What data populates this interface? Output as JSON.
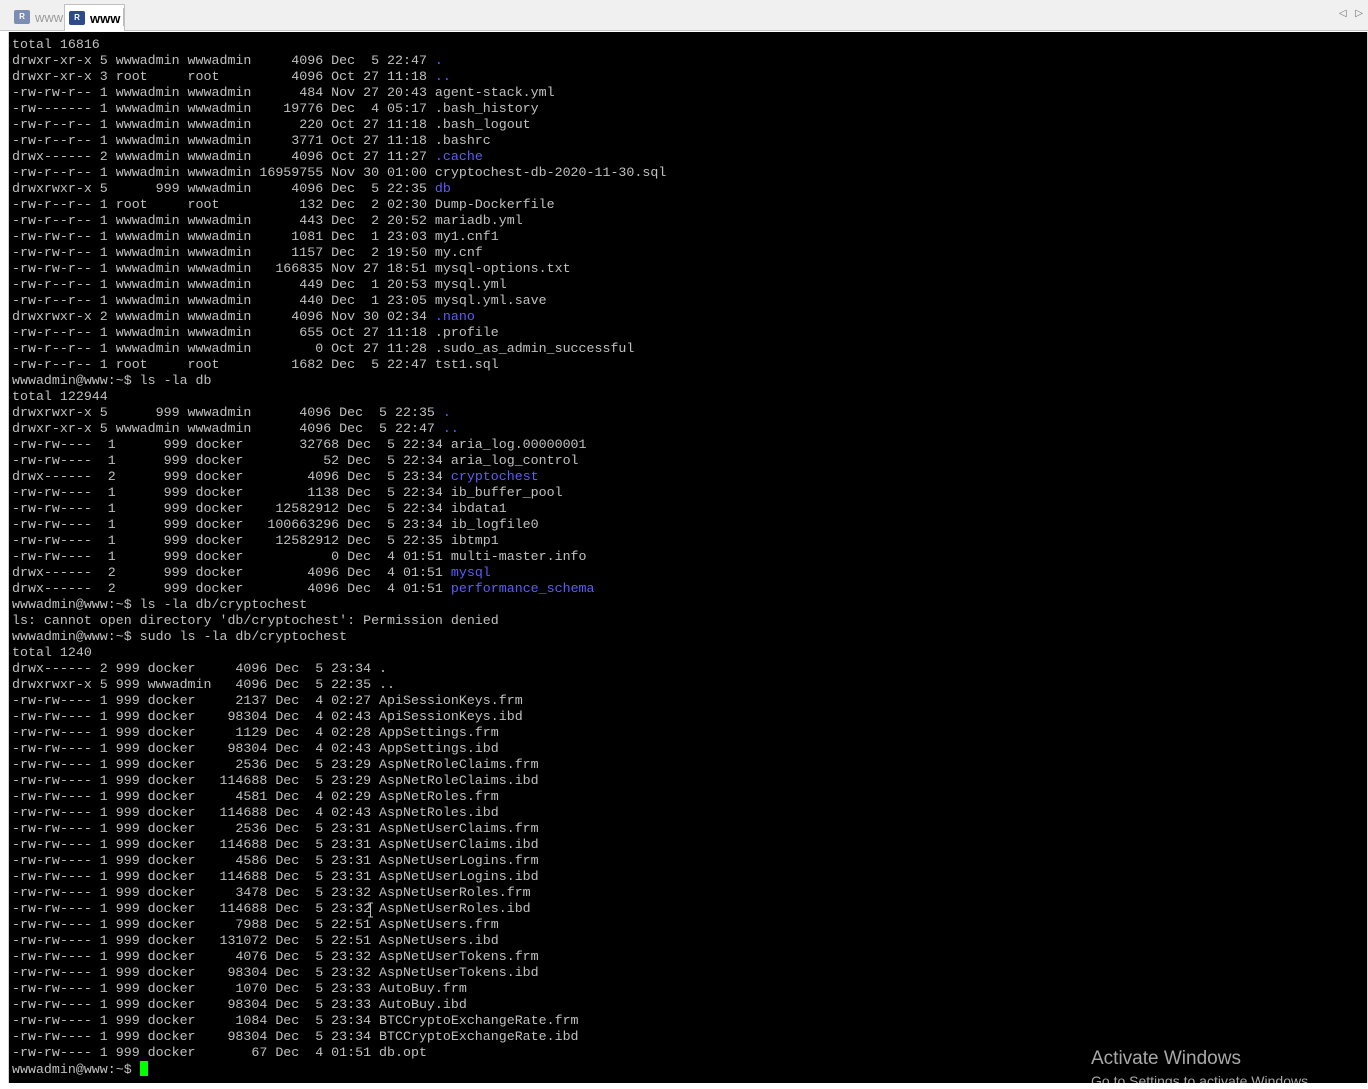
{
  "tabs": [
    {
      "label": "www",
      "icon": "putty-session-icon",
      "active": false
    },
    {
      "label": "www",
      "icon": "putty-session-icon",
      "active": true
    }
  ],
  "tab_icon_text": "R",
  "scroll_arrows": "◁ ▷",
  "terminal": {
    "lines": [
      [
        {
          "t": "total 16816"
        }
      ],
      [
        {
          "t": "drwxr-xr-x 5 wwwadmin wwwadmin     4096 Dec  5 22:47 "
        },
        {
          "t": ".",
          "dir": true
        }
      ],
      [
        {
          "t": "drwxr-xr-x 3 root     root         4096 Oct 27 11:18 "
        },
        {
          "t": "..",
          "dir": true
        }
      ],
      [
        {
          "t": "-rw-rw-r-- 1 wwwadmin wwwadmin      484 Nov 27 20:43 agent-stack.yml"
        }
      ],
      [
        {
          "t": "-rw------- 1 wwwadmin wwwadmin    19776 Dec  4 05:17 .bash_history"
        }
      ],
      [
        {
          "t": "-rw-r--r-- 1 wwwadmin wwwadmin      220 Oct 27 11:18 .bash_logout"
        }
      ],
      [
        {
          "t": "-rw-r--r-- 1 wwwadmin wwwadmin     3771 Oct 27 11:18 .bashrc"
        }
      ],
      [
        {
          "t": "drwx------ 2 wwwadmin wwwadmin     4096 Oct 27 11:27 "
        },
        {
          "t": ".cache",
          "dir": true
        }
      ],
      [
        {
          "t": "-rw-r--r-- 1 wwwadmin wwwadmin 16959755 Nov 30 01:00 cryptochest-db-2020-11-30.sql"
        }
      ],
      [
        {
          "t": "drwxrwxr-x 5      999 wwwadmin     4096 Dec  5 22:35 "
        },
        {
          "t": "db",
          "dir": true
        }
      ],
      [
        {
          "t": "-rw-r--r-- 1 root     root          132 Dec  2 02:30 Dump-Dockerfile"
        }
      ],
      [
        {
          "t": "-rw-r--r-- 1 wwwadmin wwwadmin      443 Dec  2 20:52 mariadb.yml"
        }
      ],
      [
        {
          "t": "-rw-rw-r-- 1 wwwadmin wwwadmin     1081 Dec  1 23:03 my1.cnf1"
        }
      ],
      [
        {
          "t": "-rw-rw-r-- 1 wwwadmin wwwadmin     1157 Dec  2 19:50 my.cnf"
        }
      ],
      [
        {
          "t": "-rw-rw-r-- 1 wwwadmin wwwadmin   166835 Nov 27 18:51 mysql-options.txt"
        }
      ],
      [
        {
          "t": "-rw-r--r-- 1 wwwadmin wwwadmin      449 Dec  1 20:53 mysql.yml"
        }
      ],
      [
        {
          "t": "-rw-r--r-- 1 wwwadmin wwwadmin      440 Dec  1 23:05 mysql.yml.save"
        }
      ],
      [
        {
          "t": "drwxrwxr-x 2 wwwadmin wwwadmin     4096 Nov 30 02:34 "
        },
        {
          "t": ".nano",
          "dir": true
        }
      ],
      [
        {
          "t": "-rw-r--r-- 1 wwwadmin wwwadmin      655 Oct 27 11:18 .profile"
        }
      ],
      [
        {
          "t": "-rw-r--r-- 1 wwwadmin wwwadmin        0 Oct 27 11:28 .sudo_as_admin_successful"
        }
      ],
      [
        {
          "t": "-rw-r--r-- 1 root     root         1682 Dec  5 22:47 tst1.sql"
        }
      ],
      [
        {
          "t": "wwwadmin@www:~$ ls -la db"
        }
      ],
      [
        {
          "t": "total 122944"
        }
      ],
      [
        {
          "t": "drwxrwxr-x 5      999 wwwadmin      4096 Dec  5 22:35 "
        },
        {
          "t": ".",
          "dir": true
        }
      ],
      [
        {
          "t": "drwxr-xr-x 5 wwwadmin wwwadmin      4096 Dec  5 22:47 "
        },
        {
          "t": "..",
          "dir": true
        }
      ],
      [
        {
          "t": "-rw-rw----  1      999 docker       32768 Dec  5 22:34 aria_log.00000001"
        }
      ],
      [
        {
          "t": "-rw-rw----  1      999 docker          52 Dec  5 22:34 aria_log_control"
        }
      ],
      [
        {
          "t": "drwx------  2      999 docker        4096 Dec  5 23:34 "
        },
        {
          "t": "cryptochest",
          "dir": true
        }
      ],
      [
        {
          "t": "-rw-rw----  1      999 docker        1138 Dec  5 22:34 ib_buffer_pool"
        }
      ],
      [
        {
          "t": "-rw-rw----  1      999 docker    12582912 Dec  5 22:34 ibdata1"
        }
      ],
      [
        {
          "t": "-rw-rw----  1      999 docker   100663296 Dec  5 23:34 ib_logfile0"
        }
      ],
      [
        {
          "t": "-rw-rw----  1      999 docker    12582912 Dec  5 22:35 ibtmp1"
        }
      ],
      [
        {
          "t": "-rw-rw----  1      999 docker           0 Dec  4 01:51 multi-master.info"
        }
      ],
      [
        {
          "t": "drwx------  2      999 docker        4096 Dec  4 01:51 "
        },
        {
          "t": "mysql",
          "dir": true
        }
      ],
      [
        {
          "t": "drwx------  2      999 docker        4096 Dec  4 01:51 "
        },
        {
          "t": "performance_schema",
          "dir": true
        }
      ],
      [
        {
          "t": "wwwadmin@www:~$ ls -la db/cryptochest"
        }
      ],
      [
        {
          "t": "ls: cannot open directory 'db/cryptochest': Permission denied"
        }
      ],
      [
        {
          "t": "wwwadmin@www:~$ sudo ls -la db/cryptochest"
        }
      ],
      [
        {
          "t": "total 1240"
        }
      ],
      [
        {
          "t": "drwx------ 2 999 docker     4096 Dec  5 23:34 ."
        }
      ],
      [
        {
          "t": "drwxrwxr-x 5 999 wwwadmin   4096 Dec  5 22:35 .."
        }
      ],
      [
        {
          "t": "-rw-rw---- 1 999 docker     2137 Dec  4 02:27 ApiSessionKeys.frm"
        }
      ],
      [
        {
          "t": "-rw-rw---- 1 999 docker    98304 Dec  4 02:43 ApiSessionKeys.ibd"
        }
      ],
      [
        {
          "t": "-rw-rw---- 1 999 docker     1129 Dec  4 02:28 AppSettings.frm"
        }
      ],
      [
        {
          "t": "-rw-rw---- 1 999 docker    98304 Dec  4 02:43 AppSettings.ibd"
        }
      ],
      [
        {
          "t": "-rw-rw---- 1 999 docker     2536 Dec  5 23:29 AspNetRoleClaims.frm"
        }
      ],
      [
        {
          "t": "-rw-rw---- 1 999 docker   114688 Dec  5 23:29 AspNetRoleClaims.ibd"
        }
      ],
      [
        {
          "t": "-rw-rw---- 1 999 docker     4581 Dec  4 02:29 AspNetRoles.frm"
        }
      ],
      [
        {
          "t": "-rw-rw---- 1 999 docker   114688 Dec  4 02:43 AspNetRoles.ibd"
        }
      ],
      [
        {
          "t": "-rw-rw---- 1 999 docker     2536 Dec  5 23:31 AspNetUserClaims.frm"
        }
      ],
      [
        {
          "t": "-rw-rw---- 1 999 docker   114688 Dec  5 23:31 AspNetUserClaims.ibd"
        }
      ],
      [
        {
          "t": "-rw-rw---- 1 999 docker     4586 Dec  5 23:31 AspNetUserLogins.frm"
        }
      ],
      [
        {
          "t": "-rw-rw---- 1 999 docker   114688 Dec  5 23:31 AspNetUserLogins.ibd"
        }
      ],
      [
        {
          "t": "-rw-rw---- 1 999 docker     3478 Dec  5 23:32 AspNetUserRoles.frm"
        }
      ],
      [
        {
          "t": "-rw-rw---- 1 999 docker   114688 Dec  5 23:32 AspNetUserRoles.ibd"
        }
      ],
      [
        {
          "t": "-rw-rw---- 1 999 docker     7988 Dec  5 22:51 AspNetUsers.frm"
        }
      ],
      [
        {
          "t": "-rw-rw---- 1 999 docker   131072 Dec  5 22:51 AspNetUsers.ibd"
        }
      ],
      [
        {
          "t": "-rw-rw---- 1 999 docker     4076 Dec  5 23:32 AspNetUserTokens.frm"
        }
      ],
      [
        {
          "t": "-rw-rw---- 1 999 docker    98304 Dec  5 23:32 AspNetUserTokens.ibd"
        }
      ],
      [
        {
          "t": "-rw-rw---- 1 999 docker     1070 Dec  5 23:33 AutoBuy.frm"
        }
      ],
      [
        {
          "t": "-rw-rw---- 1 999 docker    98304 Dec  5 23:33 AutoBuy.ibd"
        }
      ],
      [
        {
          "t": "-rw-rw---- 1 999 docker     1084 Dec  5 23:34 BTCCryptoExchangeRate.frm"
        }
      ],
      [
        {
          "t": "-rw-rw---- 1 999 docker    98304 Dec  5 23:34 BTCCryptoExchangeRate.ibd"
        }
      ],
      [
        {
          "t": "-rw-rw---- 1 999 docker       67 Dec  4 01:51 db.opt"
        }
      ]
    ],
    "prompt": "wwwadmin@www:~$ "
  },
  "watermark": {
    "title": "Activate Windows",
    "subtitle": "Go to Settings to activate Windows."
  },
  "colors": {
    "terminal_bg": "#000000",
    "terminal_fg": "#c0c0c0",
    "directory": "#5c5cff",
    "cursor": "#00ff00"
  }
}
